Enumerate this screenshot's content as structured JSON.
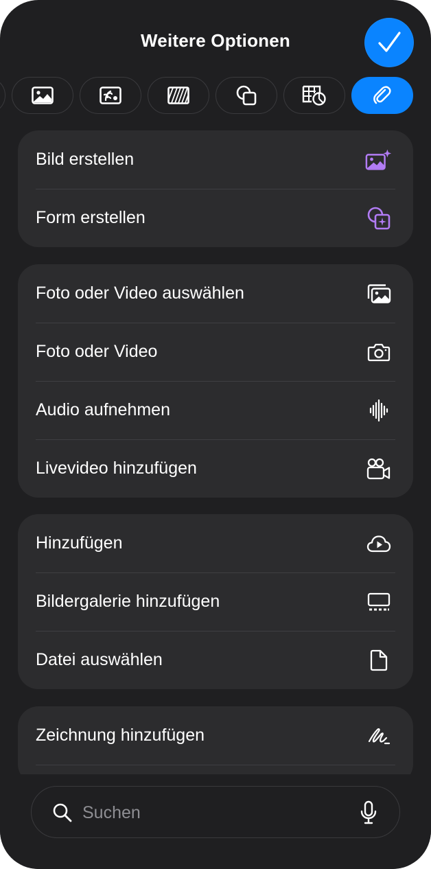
{
  "header": {
    "title": "Weitere Optionen"
  },
  "colors": {
    "accent": "#0a84ff",
    "ai_purple": "#b27cf5",
    "sheet_bg": "#1f1f21",
    "group_bg": "#2c2c2e"
  },
  "tabs": [
    {
      "icon": "partial-tab-icon"
    },
    {
      "icon": "image-icon"
    },
    {
      "icon": "media-icon"
    },
    {
      "icon": "pattern-icon"
    },
    {
      "icon": "shapes-icon"
    },
    {
      "icon": "table-chart-icon"
    },
    {
      "icon": "paperclip-icon",
      "selected": true
    }
  ],
  "groups": [
    {
      "rows": [
        {
          "label": "Bild erstellen",
          "icon": "image-sparkle-icon"
        },
        {
          "label": "Form erstellen",
          "icon": "shape-sparkle-icon"
        }
      ]
    },
    {
      "rows": [
        {
          "label": "Foto oder Video auswählen",
          "icon": "photo-library-icon"
        },
        {
          "label": "Foto oder Video",
          "icon": "camera-icon"
        },
        {
          "label": "Audio aufnehmen",
          "icon": "waveform-icon"
        },
        {
          "label": "Livevideo hinzufügen",
          "icon": "video-camera-icon"
        }
      ]
    },
    {
      "rows": [
        {
          "label": "Hinzufügen",
          "icon": "cloud-play-icon"
        },
        {
          "label": "Bildergalerie hinzufügen",
          "icon": "gallery-icon"
        },
        {
          "label": "Datei auswählen",
          "icon": "document-icon"
        }
      ]
    },
    {
      "rows": [
        {
          "label": "Zeichnung hinzufügen",
          "icon": "scribble-icon"
        }
      ]
    }
  ],
  "search": {
    "placeholder": "Suchen"
  }
}
